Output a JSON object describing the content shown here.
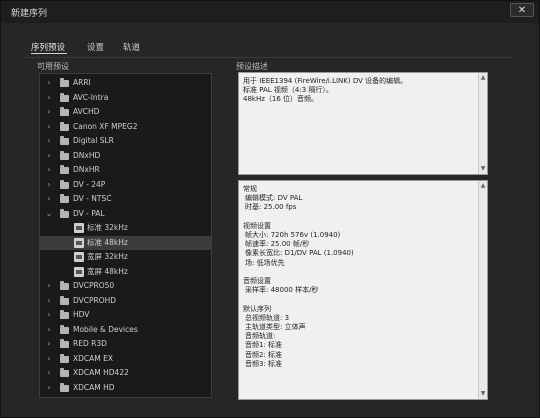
{
  "window": {
    "title": "新建序列",
    "close_glyph": "✕"
  },
  "tabs": [
    {
      "label": "序列预设",
      "active": true
    },
    {
      "label": "设置",
      "active": false
    },
    {
      "label": "轨道",
      "active": false
    }
  ],
  "presets_label": "可用预设",
  "desc_label": "预设描述",
  "tree": [
    {
      "label": "ARRI",
      "type": "folder",
      "expanded": false,
      "level": 0,
      "selected": false
    },
    {
      "label": "AVC-Intra",
      "type": "folder",
      "expanded": false,
      "level": 0,
      "selected": false
    },
    {
      "label": "AVCHD",
      "type": "folder",
      "expanded": false,
      "level": 0,
      "selected": false
    },
    {
      "label": "Canon XF MPEG2",
      "type": "folder",
      "expanded": false,
      "level": 0,
      "selected": false
    },
    {
      "label": "Digital SLR",
      "type": "folder",
      "expanded": false,
      "level": 0,
      "selected": false
    },
    {
      "label": "DNxHD",
      "type": "folder",
      "expanded": false,
      "level": 0,
      "selected": false
    },
    {
      "label": "DNxHR",
      "type": "folder",
      "expanded": false,
      "level": 0,
      "selected": false
    },
    {
      "label": "DV - 24P",
      "type": "folder",
      "expanded": false,
      "level": 0,
      "selected": false
    },
    {
      "label": "DV - NTSC",
      "type": "folder",
      "expanded": false,
      "level": 0,
      "selected": false
    },
    {
      "label": "DV - PAL",
      "type": "folder",
      "expanded": true,
      "level": 0,
      "selected": false
    },
    {
      "label": "标准 32kHz",
      "type": "file",
      "expanded": false,
      "level": 1,
      "selected": false
    },
    {
      "label": "标准 48kHz",
      "type": "file",
      "expanded": false,
      "level": 1,
      "selected": true
    },
    {
      "label": "宽屏 32kHz",
      "type": "file",
      "expanded": false,
      "level": 1,
      "selected": false
    },
    {
      "label": "宽屏 48kHz",
      "type": "file",
      "expanded": false,
      "level": 1,
      "selected": false
    },
    {
      "label": "DVCPRO50",
      "type": "folder",
      "expanded": false,
      "level": 0,
      "selected": false
    },
    {
      "label": "DVCPROHD",
      "type": "folder",
      "expanded": false,
      "level": 0,
      "selected": false
    },
    {
      "label": "HDV",
      "type": "folder",
      "expanded": false,
      "level": 0,
      "selected": false
    },
    {
      "label": "Mobile & Devices",
      "type": "folder",
      "expanded": false,
      "level": 0,
      "selected": false
    },
    {
      "label": "RED R3D",
      "type": "folder",
      "expanded": false,
      "level": 0,
      "selected": false
    },
    {
      "label": "XDCAM EX",
      "type": "folder",
      "expanded": false,
      "level": 0,
      "selected": false
    },
    {
      "label": "XDCAM HD422",
      "type": "folder",
      "expanded": false,
      "level": 0,
      "selected": false
    },
    {
      "label": "XDCAM HD",
      "type": "folder",
      "expanded": false,
      "level": 0,
      "selected": false
    }
  ],
  "description_lines": [
    "用于 IEEE1394 (FireWire/i.LINK) DV 设备的编辑。",
    "标准 PAL 视频（4:3 隔行）。",
    "48kHz（16 位）音频。"
  ],
  "details_lines": [
    {
      "text": "常规",
      "indent": false
    },
    {
      "text": "编辑模式: DV PAL",
      "indent": true
    },
    {
      "text": "时基: 25.00 fps",
      "indent": true
    },
    {
      "text": "",
      "indent": false
    },
    {
      "text": "视频设置",
      "indent": false
    },
    {
      "text": "帧大小: 720h 576v (1.0940)",
      "indent": true
    },
    {
      "text": "帧速率: 25.00 帧/秒",
      "indent": true
    },
    {
      "text": "像素长宽比: D1/DV PAL (1.0940)",
      "indent": true
    },
    {
      "text": "场: 低场优先",
      "indent": true
    },
    {
      "text": "",
      "indent": false
    },
    {
      "text": "音频设置",
      "indent": false
    },
    {
      "text": "采样率: 48000 样本/秒",
      "indent": true
    },
    {
      "text": "",
      "indent": false
    },
    {
      "text": "默认序列",
      "indent": false
    },
    {
      "text": "总视频轨道: 3",
      "indent": true
    },
    {
      "text": "主轨道类型: 立体声",
      "indent": true
    },
    {
      "text": "音频轨道:",
      "indent": true
    },
    {
      "text": "音频1: 标准",
      "indent": true
    },
    {
      "text": "音频2: 标准",
      "indent": true
    },
    {
      "text": "音频3: 标准",
      "indent": true
    }
  ],
  "colors": {
    "panel": "#262626",
    "tree_bg": "#1a1a1a",
    "selected_row": "#3c3c3c",
    "text_box": "#f0f0f0"
  },
  "icons": {
    "collapsed": "chevron-right-icon",
    "expanded": "chevron-down-icon",
    "folder": "folder-icon",
    "preset": "preset-file-icon"
  }
}
